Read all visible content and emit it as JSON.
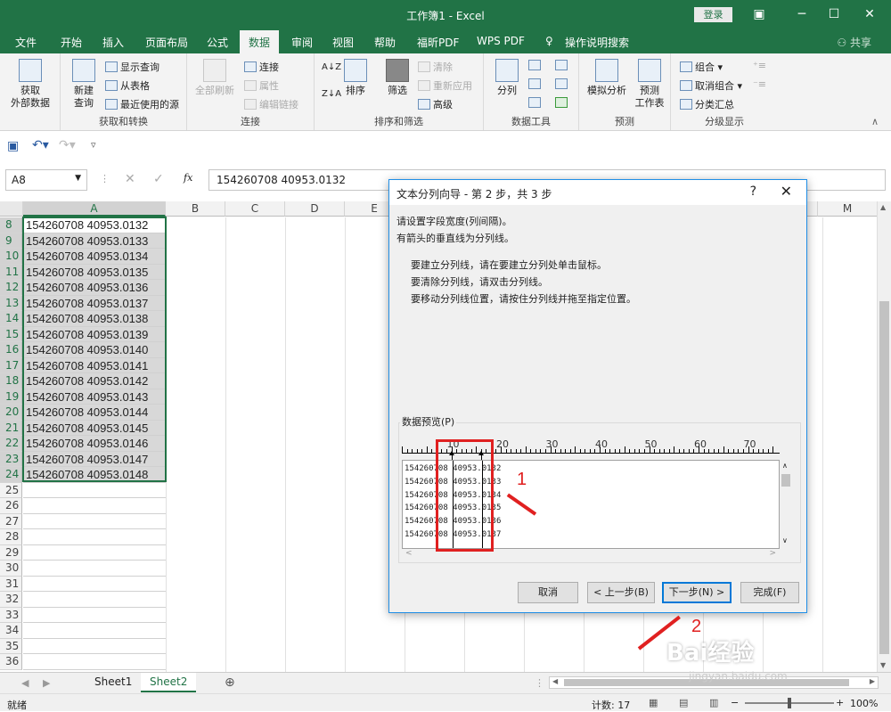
{
  "window": {
    "title": "工作簿1  -  Excel",
    "login": "登录"
  },
  "tabs": [
    "文件",
    "开始",
    "插入",
    "页面布局",
    "公式",
    "数据",
    "审阅",
    "视图",
    "帮助",
    "福昕PDF",
    "WPS PDF",
    "操作说明搜索"
  ],
  "active_tab": "数据",
  "share": "共享",
  "ribbon": {
    "get_external": "获取\n外部数据",
    "new_query": "新建\n查询",
    "show_query": "显示查询",
    "from_table": "从表格",
    "recent_sources": "最近使用的源",
    "group1": "获取和转换",
    "refresh_all": "全部刷新",
    "connections": "连接",
    "properties": "属性",
    "edit_links": "编辑链接",
    "group2": "连接",
    "sort": "排序",
    "filter": "筛选",
    "clear": "清除",
    "reapply": "重新应用",
    "advanced": "高级",
    "group3": "排序和筛选",
    "text_to_columns": "分列",
    "group4": "数据工具",
    "what_if": "模拟分析",
    "forecast_sheet": "预测\n工作表",
    "group5": "预测",
    "group_btn": "组合",
    "ungroup_btn": "取消组合",
    "subtotal": "分类汇总",
    "group6": "分级显示"
  },
  "formula_bar": {
    "name_box": "A8",
    "formula": "154260708 40953.0132",
    "fx": "fx"
  },
  "columns": [
    "A",
    "B",
    "C",
    "D",
    "E",
    "M"
  ],
  "rows": [
    "8",
    "9",
    "10",
    "11",
    "12",
    "13",
    "14",
    "15",
    "16",
    "17",
    "18",
    "19",
    "20",
    "21",
    "22",
    "23",
    "24",
    "25",
    "26",
    "27",
    "28",
    "29",
    "30",
    "31",
    "32",
    "33",
    "34",
    "35",
    "36"
  ],
  "cells": [
    "154260708 40953.0132",
    "154260708 40953.0133",
    "154260708 40953.0134",
    "154260708 40953.0135",
    "154260708 40953.0136",
    "154260708 40953.0137",
    "154260708 40953.0138",
    "154260708 40953.0139",
    "154260708 40953.0140",
    "154260708 40953.0141",
    "154260708 40953.0142",
    "154260708 40953.0143",
    "154260708 40953.0144",
    "154260708 40953.0145",
    "154260708 40953.0146",
    "154260708 40953.0147",
    "154260708 40953.0148"
  ],
  "sheets": [
    "Sheet1",
    "Sheet2"
  ],
  "active_sheet": "Sheet2",
  "status": {
    "ready": "就绪",
    "count": "计数: 17",
    "zoom": "100%"
  },
  "dialog": {
    "title": "文本分列向导 - 第 2 步，共 3 步",
    "help": "?",
    "intro1": "请设置字段宽度(列间隔)。",
    "intro2": "有箭头的垂直线为分列线。",
    "tip1": "要建立分列线，请在要建立分列处单击鼠标。",
    "tip2": "要清除分列线，请双击分列线。",
    "tip3": "要移动分列线位置，请按住分列线并拖至指定位置。",
    "preview_label": "数据预览(P)",
    "ruler": [
      "10",
      "20",
      "30",
      "40",
      "50",
      "60",
      "70"
    ],
    "preview_rows": [
      "154260708 40953.0132",
      "154260708 40953.0133",
      "154260708 40953.0134",
      "154260708 40953.0135",
      "154260708 40953.0136",
      "154260708 40953.0137"
    ],
    "cancel": "取消",
    "back": "< 上一步(B)",
    "next": "下一步(N) >",
    "finish": "完成(F)"
  },
  "annotations": {
    "label1": "1",
    "label2": "2",
    "color": "#e02020"
  },
  "watermark": {
    "text": "Bai经验",
    "url": "jingyan.baidu.com"
  }
}
